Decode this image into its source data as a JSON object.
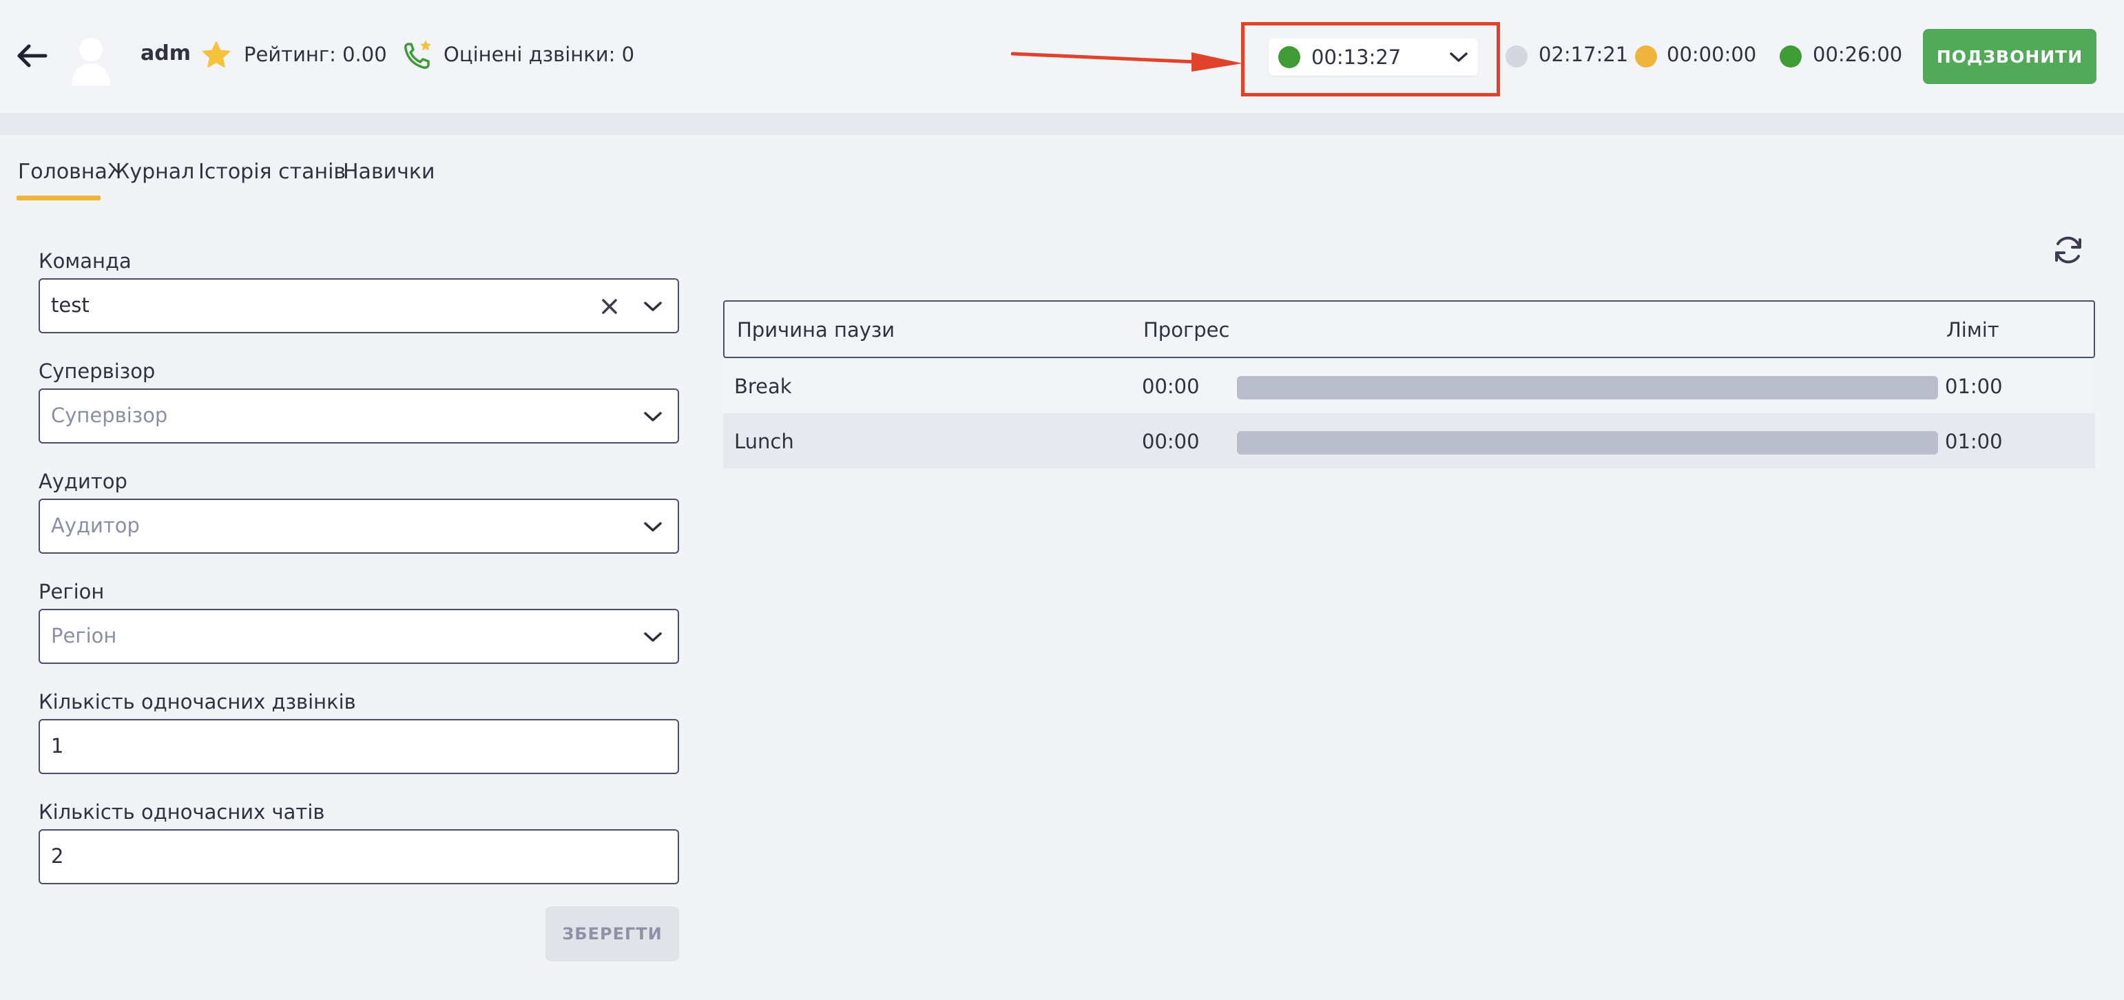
{
  "header": {
    "username": "adm",
    "rating": "Рейтинг: 0.00",
    "rated_calls": "Оцінені дзвінки: 0",
    "status_select": {
      "value": "00:13:27",
      "color": "#3f9b35"
    },
    "timers": [
      {
        "value": "02:17:21",
        "color": "#d5d7df"
      },
      {
        "value": "00:00:00",
        "color": "#f0b43c"
      },
      {
        "value": "00:26:00",
        "color": "#3f9b35"
      }
    ],
    "call_button": "ПОДЗВОНИТИ",
    "icons": [
      "back-arrow-icon",
      "avatar-icon",
      "star-icon",
      "phone-star-icon",
      "chevron-down-icon"
    ]
  },
  "tabs": [
    {
      "label": "Головна",
      "active": true
    },
    {
      "label": "Журнал",
      "active": false
    },
    {
      "label": "Історія станів",
      "active": false
    },
    {
      "label": "Навички",
      "active": false
    }
  ],
  "form": {
    "team": {
      "label": "Команда",
      "value": "test"
    },
    "supervisor": {
      "label": "Супервізор",
      "placeholder": "Супервізор"
    },
    "auditor": {
      "label": "Аудитор",
      "placeholder": "Аудитор"
    },
    "region": {
      "label": "Регіон",
      "placeholder": "Регіон"
    },
    "concurrent_calls": {
      "label": "Кількість одночасних дзвінків",
      "value": "1"
    },
    "concurrent_chats": {
      "label": "Кількість одночасних чатів",
      "value": "2"
    },
    "save_button": "ЗБЕРЕГТИ"
  },
  "pause_table": {
    "columns": [
      "Причина паузи",
      "Прогрес",
      "Ліміт"
    ],
    "rows": [
      {
        "reason": "Break",
        "used": "00:00",
        "progress": 0,
        "limit": "01:00"
      },
      {
        "reason": "Lunch",
        "used": "00:00",
        "progress": 0,
        "limit": "01:00"
      }
    ]
  },
  "colors": {
    "accent_green": "#53a95a",
    "tab_underline": "#f0b43c",
    "highlight_red": "#e0432b"
  }
}
